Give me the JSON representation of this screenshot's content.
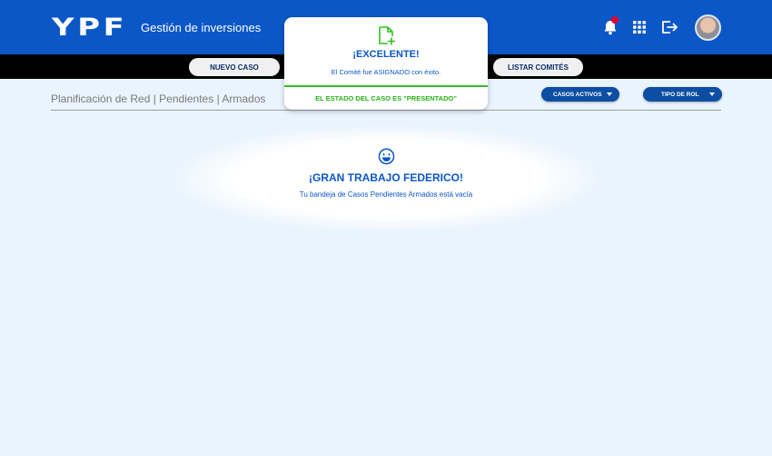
{
  "header": {
    "logo_text": "YPF",
    "app_title": "Gestión de inversiones",
    "icons": [
      "bell-icon",
      "apps-grid-icon",
      "logout-icon"
    ],
    "notification_dot_color": "#e4002b"
  },
  "nav": {
    "new_case_label": "NUEVO CASO",
    "list_committees_label": "LISTAR COMITÉS"
  },
  "breadcrumb": "Planificación de Red | Pendientes | Armados",
  "filters": {
    "active_cases_label": "CASOS ACTIVOS",
    "role_type_label": "TIPO DE ROL"
  },
  "empty_state": {
    "icon": "smile-icon",
    "title": "¡GRAN TRABAJO FEDERICO!",
    "subtitle": "Tu bandeja de Casos Pendientes Armados está vacía"
  },
  "toast": {
    "icon": "document-add-icon",
    "title": "¡EXCELENTE!",
    "message": "El Comité fue ASIGNADO con éxito.",
    "status": "EL ESTADO DEL CASO ES \"PRESENTADO\"",
    "accent_color": "#2fbf22"
  },
  "colors": {
    "brand_blue": "#0b57c8",
    "nav_black": "#000000",
    "background": "#eaf4fd"
  }
}
